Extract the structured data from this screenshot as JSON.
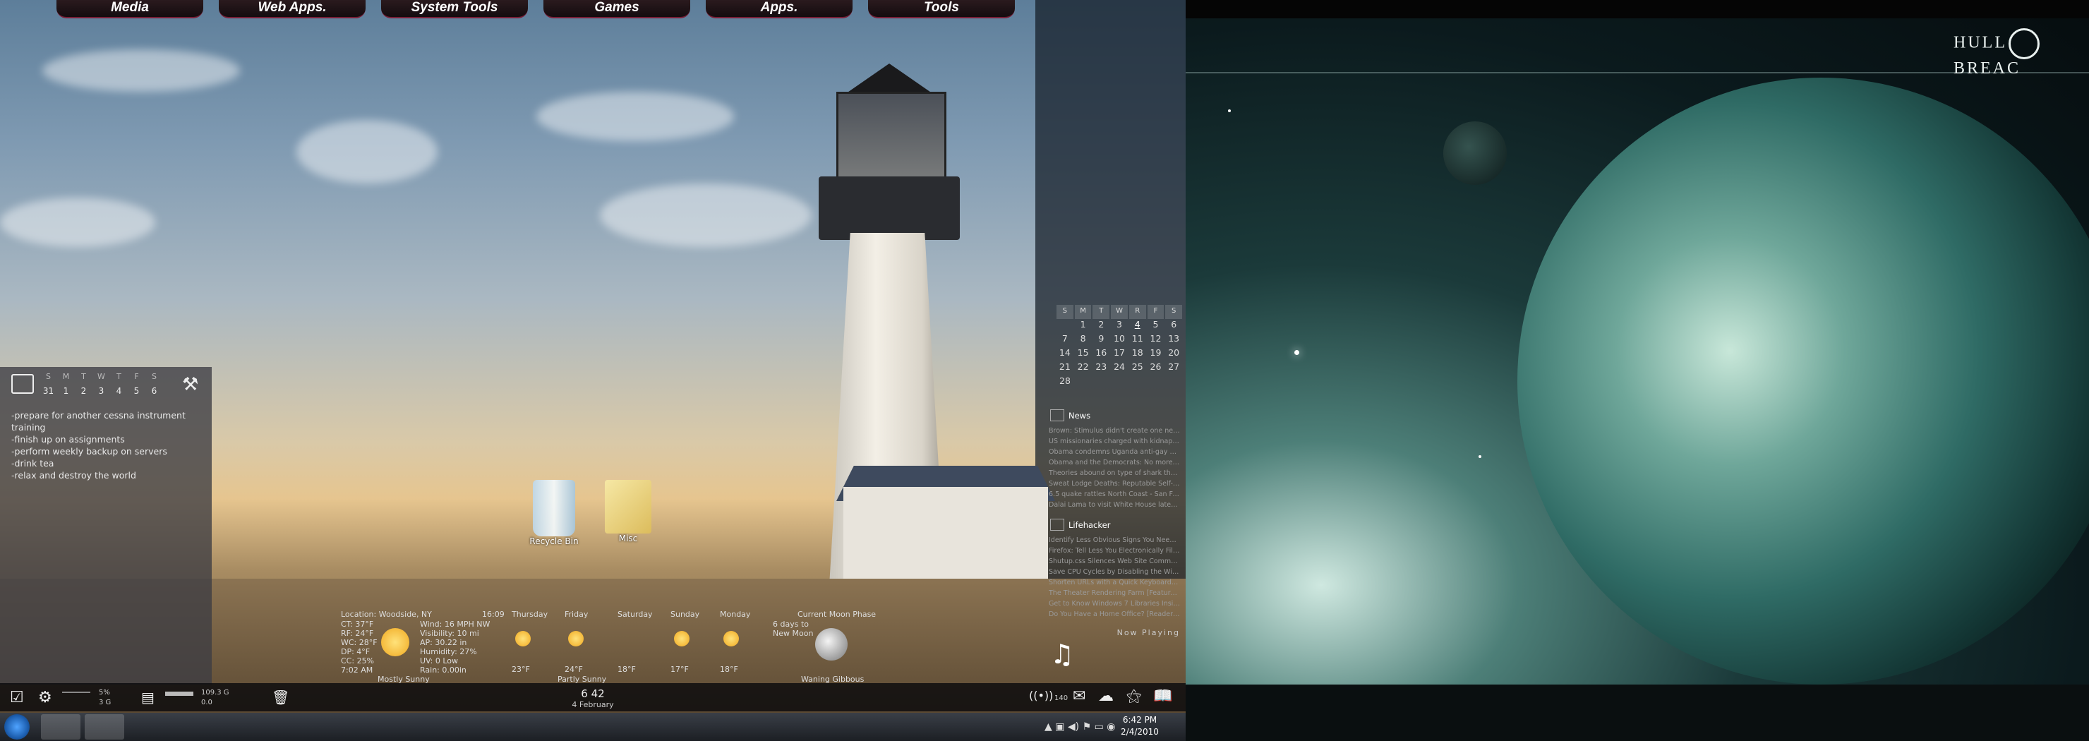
{
  "launcher_tabs": [
    "Media",
    "Web Apps.",
    "System Tools",
    "Games",
    "Apps.",
    "Tools"
  ],
  "todo": {
    "day_headers": [
      "S",
      "M",
      "T",
      "W",
      "T",
      "F",
      "S"
    ],
    "dates": [
      "31",
      "1",
      "2",
      "3",
      "4",
      "5",
      "6"
    ],
    "items": [
      "-prepare for another cessna instrument",
      "training",
      "-finish up on assignments",
      "-perform weekly backup on servers",
      "-drink tea",
      "-relax and destroy the world"
    ]
  },
  "desktop_icons": {
    "recycle_bin": "Recycle Bin",
    "folder": "Misc"
  },
  "weather": {
    "location": "Location: Woodside, NY",
    "time": "16:09",
    "current": [
      "CT: 37°F",
      "RF: 24°F",
      "WC: 28°F",
      "DP: 4°F",
      "CC: 25%",
      "7:02 AM"
    ],
    "wind": [
      "Wind: 16 MPH NW",
      "Visibility: 10 mi",
      "AP: 30.22 in",
      "Humidity: 27%",
      "UV: 0 Low",
      "Rain: 0.00in"
    ],
    "condition": "Mostly Sunny",
    "forecast_days": [
      "Thursday",
      "Friday",
      "Saturday",
      "Sunday",
      "Monday"
    ],
    "forecast_temps": [
      "23°F",
      "24°F",
      "18°F",
      "17°F",
      "18°F"
    ],
    "moon_phase_title": "Current Moon Phase",
    "moon_text": [
      "6 days to",
      "New Moon"
    ],
    "moon_phase": "Waning Gibbous",
    "bottom_condition": "Partly Sunny"
  },
  "right_calendar": {
    "headers": [
      "S",
      "M",
      "T",
      "W",
      "R",
      "F",
      "S"
    ],
    "rows": [
      [
        "",
        "1",
        "2",
        "3",
        "4",
        "5",
        "6"
      ],
      [
        "7",
        "8",
        "9",
        "10",
        "11",
        "12",
        "13"
      ],
      [
        "14",
        "15",
        "16",
        "17",
        "18",
        "19",
        "20"
      ],
      [
        "21",
        "22",
        "23",
        "24",
        "25",
        "26",
        "27"
      ],
      [
        "28",
        "",
        "",
        "",
        "",
        "",
        ""
      ]
    ]
  },
  "feeds": {
    "news_title": "News",
    "news_items": [
      "Brown: Stimulus didn't create one new...",
      "US missionaries charged with kidnappin...",
      "Obama condemns Uganda anti-gay bill...",
      "Obama and the Democrats: No more st...",
      "Theories abound on type of shark that...",
      "Sweat Lodge Deaths: Reputable Self-Hel...",
      "6.5 quake rattles North Coast - San Fra...",
      "Dalai Lama to visit White House later t..."
    ],
    "lifehacker_title": "Lifehacker",
    "lifehacker_items": [
      "Identify Less Obvious Signs You Need t...",
      "Firefox: Tell Less You Electronically Fill ...",
      "Shutup.css Silences Web Site Comment...",
      "Save CPU Cycles by Disabling the Wind...",
      "Shorten URLs with a Quick Keyboard Sh...",
      "The Theater Rendering Farm [Featured...",
      "Get to Know Windows 7 Libraries Insid...",
      "Do You Have a Home Office? [Reader P..."
    ],
    "now_playing": "Now Playing"
  },
  "statbar": {
    "cpu": "5%",
    "ram": "3 G",
    "disk": "109.3 G",
    "disk2": "0.0",
    "clock_time": "6 42",
    "clock_date": "4 February",
    "mail_count": "140"
  },
  "taskbar": {
    "time": "6:42 PM",
    "date": "2/4/2010"
  },
  "right_logo": {
    "text_left": "HULL",
    "text_right": "BREAC"
  }
}
